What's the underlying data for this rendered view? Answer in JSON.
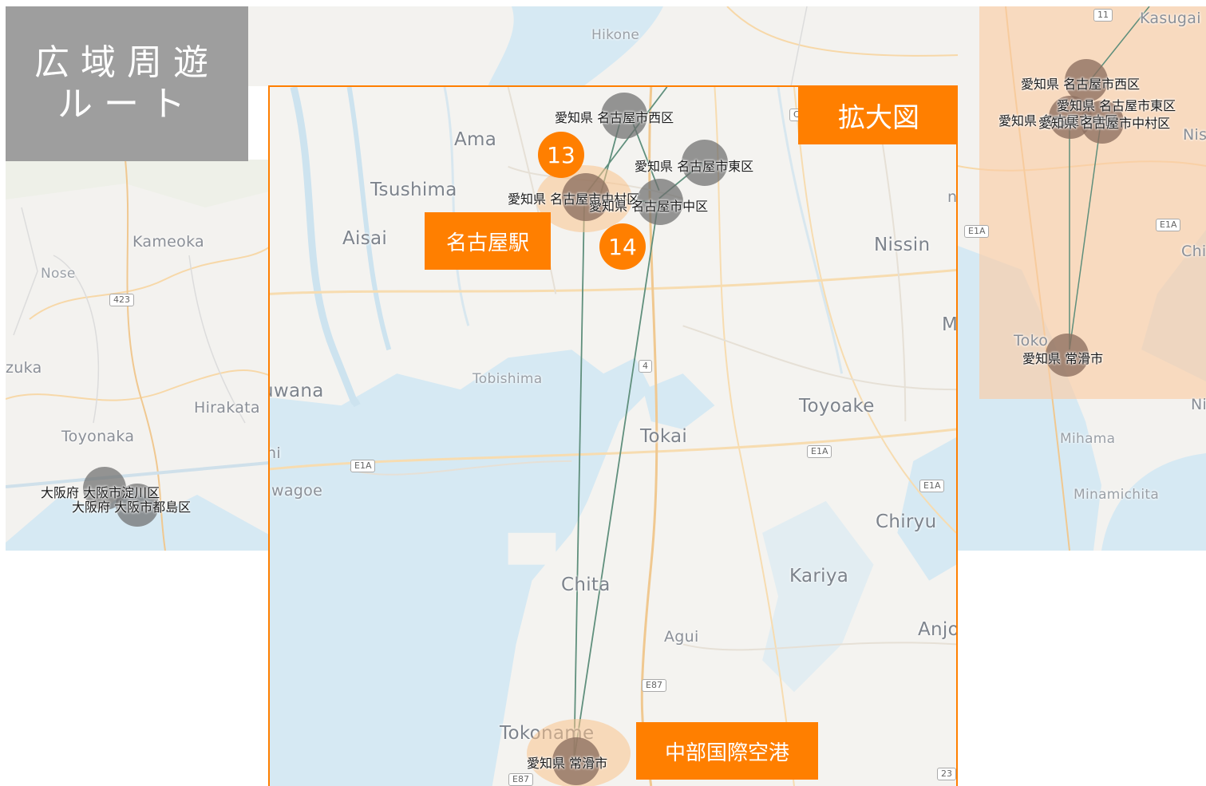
{
  "title": {
    "line1": "広域周遊",
    "line2": "ルート"
  },
  "callouts": {
    "zoom_label": "拡大図",
    "station_label": "名古屋駅",
    "airport_label": "中部国際空港"
  },
  "steps": [
    "13",
    "14"
  ],
  "colors": {
    "accent": "#ff7f00",
    "route_line": "#5f8f7c",
    "title_bg": "#9e9e9e",
    "halo": "#fac38c"
  },
  "left_map": {
    "place_labels": [
      "Kameoka",
      "Nose",
      "zuka",
      "Toyonaka",
      "Hirakata"
    ],
    "road_shields": [
      "423"
    ],
    "nodes": [
      {
        "name": "大阪府 大阪市淀川区"
      },
      {
        "name": "大阪府 大阪市都島区"
      }
    ]
  },
  "top_map": {
    "place_labels": [
      "Hikone"
    ]
  },
  "right_map": {
    "place_labels": [
      "Kasugai",
      "Nis",
      "Chi",
      "Toko",
      "Mihama",
      "Minamichita",
      "Ni"
    ],
    "road_shields": [
      "11",
      "E1A",
      "E1A"
    ],
    "nodes": [
      {
        "name": "愛知県 名古屋市西区"
      },
      {
        "name": "愛知県 名古屋市東区"
      },
      {
        "name": "愛知県 名古屋市中区"
      },
      {
        "name": "愛知県 名古屋市中村区"
      },
      {
        "name": "愛知県 常滑市"
      }
    ]
  },
  "zoom_map": {
    "place_labels": [
      "Ama",
      "Tsushima",
      "Aisai",
      "Nissin",
      "M",
      "uwana",
      "hi",
      "wagoe",
      "Tobishima",
      "Tokai",
      "Toyoake",
      "Chiryu",
      "Kariya",
      "Chita",
      "Agui",
      "Anjo",
      "Tokoname",
      "na"
    ],
    "road_shields": [
      "C",
      "4",
      "E1A",
      "E1A",
      "E1A",
      "E87",
      "E87",
      "23"
    ],
    "nodes": [
      {
        "name": "愛知県 名古屋市西区"
      },
      {
        "name": "愛知県 名古屋市東区"
      },
      {
        "name": "愛知県 名古屋市中村区"
      },
      {
        "name": "愛知県 名古屋市中区"
      },
      {
        "name": "愛知県 常滑市"
      }
    ]
  }
}
